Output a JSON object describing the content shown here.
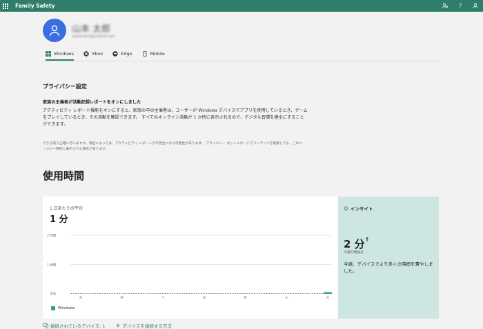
{
  "app": {
    "title": "Family Safety"
  },
  "topbar": {
    "icons": [
      "family-settings-icon",
      "help-icon",
      "account-icon"
    ],
    "help_label": "?"
  },
  "user": {
    "name": "山本 太郎",
    "email": "yamamoto@outlook.com"
  },
  "tabs": [
    {
      "label": "Windows",
      "icon": "windows-icon",
      "active": true
    },
    {
      "label": "Xbox",
      "icon": "xbox-icon",
      "active": false
    },
    {
      "label": "Edge",
      "icon": "edge-icon",
      "active": false
    },
    {
      "label": "Mobile",
      "icon": "mobile-icon",
      "active": false
    }
  ],
  "privacy": {
    "title": "プライバシー設定",
    "subtitle": "家族の主催者が活動記録レポートをオンにしました",
    "body": "アクティビティ レポート機能をオンにすると、家族の中の主催者は、ユーザーが Windows デバイスでアプリを使用しているとき、ゲームをプレイしているとき、その活動を確認できます。 すべてのオンライン活動が 1 か所に表示されるので、デジタル習慣を健全にすることができます。",
    "note": "できる限り正確に行いますが、場合によっては、アクティビティ レポートが不完全になる可能性があります。 プライバシー ダッシュボードでコンテンツを削除しても、このページに一時的に表示される場合があります。"
  },
  "usage": {
    "title": "使用時間",
    "avg_label": "1 日あたりの平均",
    "avg_value": "1 分",
    "legend": "Windows",
    "insight_title": "インサイト",
    "insight_value": "2 分",
    "insight_arrow": "↑",
    "insight_sub": "今週の増加分",
    "insight_desc": "今週、デバイスでより多くの時間を費やしました。"
  },
  "chart_data": {
    "type": "bar",
    "categories": [
      "木",
      "金",
      "土",
      "日",
      "月",
      "火",
      "水"
    ],
    "series": [
      {
        "name": "Windows",
        "values": [
          0,
          0,
          0,
          0,
          0,
          0,
          2
        ]
      }
    ],
    "yunit": "分",
    "y_ticks": [
      {
        "label": "2 時間",
        "value": 120
      },
      {
        "label": "1 時間",
        "value": 60
      }
    ],
    "average_label": "平均",
    "average_value": 1,
    "ylim": [
      0,
      120
    ],
    "legend": "bottom-left",
    "grid": true,
    "colors": {
      "bar": "#3aa08a",
      "grid": "#d0d0d0"
    }
  },
  "footer": {
    "connected_devices": "接続されているデバイス: 1",
    "how_to_connect": "デバイスを接続する方法"
  },
  "colors": {
    "brand": "#2f7e6b",
    "insight_bg": "#cde6e1",
    "avatar": "#3b6ee0"
  }
}
